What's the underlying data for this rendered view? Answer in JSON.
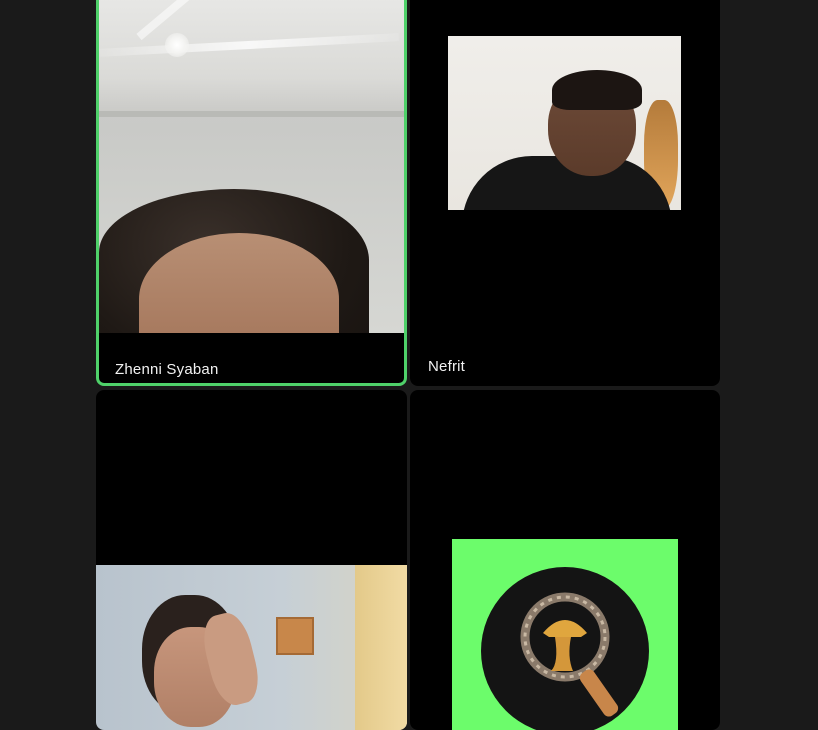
{
  "participants": [
    {
      "name": "Zhenni Syaban",
      "active_speaker": true,
      "video": "on"
    },
    {
      "name": "Nefrit",
      "active_speaker": false,
      "video": "on"
    },
    {
      "name": "",
      "active_speaker": false,
      "video": "on"
    },
    {
      "name": "",
      "active_speaker": false,
      "video": "profile-logo",
      "logo_icon": "magnifying-glass-detective-icon"
    }
  ],
  "colors": {
    "background": "#1a1a1a",
    "tile_background": "#000000",
    "active_speaker_border": "#4fd16a",
    "logo_background": "#6cfc6b"
  }
}
